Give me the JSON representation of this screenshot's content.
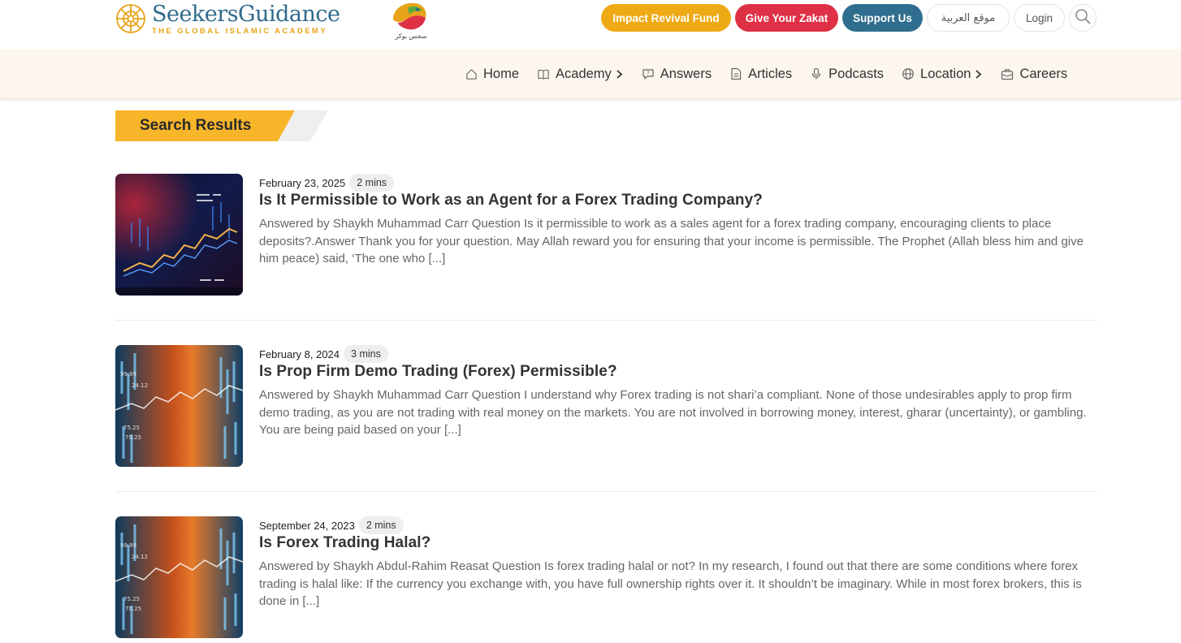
{
  "brand": {
    "name": "SeekersGuidance",
    "tagline": "THE GLOBAL ISLAMIC ACADEMY",
    "partner_caption": "سجس بوكر",
    "colors": {
      "blue": "#2f6a8c",
      "gold": "#e8a319"
    }
  },
  "top_actions": {
    "impact": "Impact Revival Fund",
    "zakat": "Give Your Zakat",
    "support": "Support Us",
    "arabic": "موقع العربية",
    "login": "Login",
    "colors": {
      "impact": "#eeaa14",
      "zakat": "#de3146",
      "support": "#2f6e8e"
    }
  },
  "nav": {
    "items": [
      {
        "label": "Home",
        "icon": "home-icon",
        "has_submenu": false
      },
      {
        "label": "Academy",
        "icon": "book-icon",
        "has_submenu": true
      },
      {
        "label": "Answers",
        "icon": "question-bubble-icon",
        "has_submenu": false
      },
      {
        "label": "Articles",
        "icon": "document-icon",
        "has_submenu": false
      },
      {
        "label": "Podcasts",
        "icon": "microphone-icon",
        "has_submenu": false
      },
      {
        "label": "Location",
        "icon": "globe-icon",
        "has_submenu": true
      },
      {
        "label": "Careers",
        "icon": "briefcase-icon",
        "has_submenu": false
      }
    ]
  },
  "page": {
    "heading": "Search Results"
  },
  "results": [
    {
      "date": "February 23, 2025",
      "read_time": "2 mins",
      "title": "Is It Permissible to Work as an Agent for a Forex Trading Company?",
      "excerpt": "Answered by Shaykh Muhammad Carr Question  Is it permissible to work as a sales agent for a forex trading company, encouraging clients to place deposits?.Answer Thank you for your question. May Allah reward you for ensuring that your income is permissible. The Prophet (Allah bless him and give him peace) said, ‘The one who [...]"
    },
    {
      "date": "February 8, 2024",
      "read_time": "3 mins",
      "title": "Is Prop Firm Demo Trading (Forex) Permissible?",
      "excerpt": "Answered by Shaykh Muhammad Carr Question  I understand why Forex trading is not shari’a compliant. None of those undesirables apply to prop firm demo trading, as you are not trading with real money on the markets. You are not involved in borrowing money, interest, gharar (uncertainty), or gambling. You are being paid based on your [...]"
    },
    {
      "date": "September 24, 2023",
      "read_time": "2 mins",
      "title": "Is Forex Trading Halal?",
      "excerpt": "Answered by Shaykh Abdul-Rahim Reasat Question Is forex trading halal or not? In my research, I found out that there are some conditions where forex trading is halal like: If the currency you exchange with, you have full ownership rights over it. It shouldn’t be imaginary. While in most forex brokers, this is done in [...]"
    }
  ]
}
